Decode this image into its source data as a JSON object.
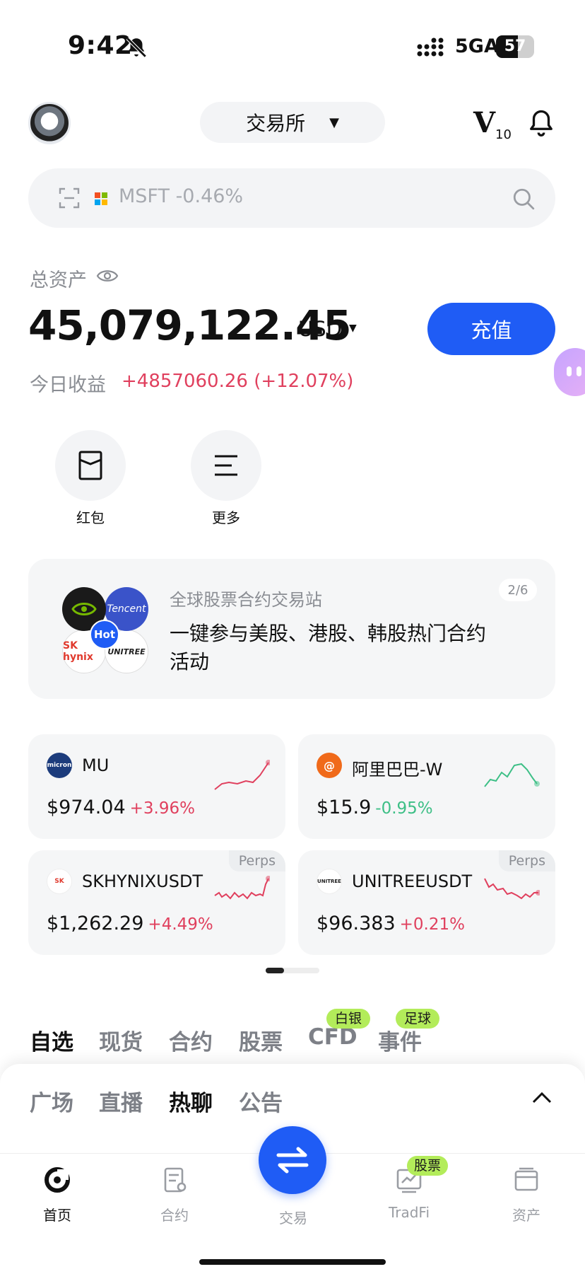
{
  "status_bar": {
    "time": "9:42",
    "network": "5GA",
    "battery": "57"
  },
  "header": {
    "exchange_selector": "交易所",
    "vip_level": "V",
    "vip_number": "10"
  },
  "search": {
    "placeholder": "MSFT -0.46%"
  },
  "assets": {
    "label": "总资产",
    "total": "45,079,122.45",
    "currency": "USD",
    "deposit_label": "充值",
    "pnl_label": "今日收益",
    "pnl_value": "+4857060.26 (+12.07%)"
  },
  "shortcuts": [
    {
      "label": "红包",
      "icon": "red-packet-icon"
    },
    {
      "label": "更多",
      "icon": "menu-icon"
    }
  ],
  "banner": {
    "subtitle": "全球股票合约交易站",
    "title": "一键参与美股、港股、韩股热门合约活动",
    "page": "2/6",
    "logos": {
      "tencent": "Tencent",
      "sk": "SK hynix",
      "unitree": "UNITREE",
      "hot": "Hot"
    }
  },
  "cards": [
    {
      "name": "MU",
      "price": "$974.04",
      "change": "+3.96%",
      "trend": "up",
      "tag": ""
    },
    {
      "name": "阿里巴巴-W",
      "price": "$15.9",
      "change": "-0.95%",
      "trend": "down",
      "tag": ""
    },
    {
      "name": "SKHYNIXUSDT",
      "price": "$1,262.29",
      "change": "+4.49%",
      "trend": "up",
      "tag": "Perps"
    },
    {
      "name": "UNITREEUSDT",
      "price": "$96.383",
      "change": "+0.21%",
      "trend": "up",
      "tag": "Perps"
    }
  ],
  "market_tabs": [
    {
      "label": "自选",
      "active": true
    },
    {
      "label": "现货"
    },
    {
      "label": "合约"
    },
    {
      "label": "股票"
    },
    {
      "label": "CFD",
      "badge": "白银"
    },
    {
      "label": "事件",
      "badge": "足球"
    }
  ],
  "feed_tabs": [
    {
      "label": "广场"
    },
    {
      "label": "直播"
    },
    {
      "label": "热聊",
      "active": true
    },
    {
      "label": "公告"
    }
  ],
  "bottom_nav": [
    {
      "label": "首页",
      "active": true
    },
    {
      "label": "合约"
    },
    {
      "label": "交易"
    },
    {
      "label": "TradFi",
      "badge": "股票"
    },
    {
      "label": "资产"
    }
  ],
  "colors": {
    "accent": "#1f5cf5",
    "up": "#e0405e",
    "down": "#3dbf86",
    "badge": "#b3ec5a"
  }
}
